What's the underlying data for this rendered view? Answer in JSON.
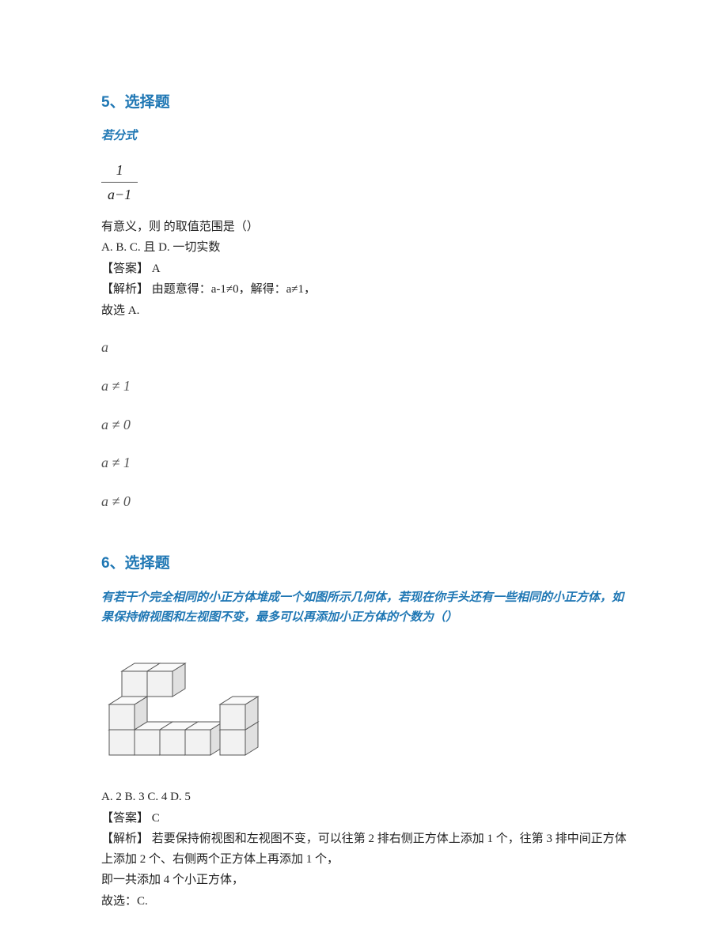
{
  "q5": {
    "header": "5、选择题",
    "stem": "若分式",
    "frac_num": "1",
    "frac_den": "a−1",
    "stem_tail": "有意义，则 的取值范围是（）",
    "options": "A. B. C. 且 D. 一切实数",
    "ans_label": "【答案】",
    "ans_value": "A",
    "exp_label": "【解析】",
    "exp_line1": "由题意得：a-1≠0，解得：a≠1，",
    "exp_line2": "故选 A.",
    "m1": "a",
    "m2": "a ≠ 1",
    "m3": "a ≠ 0",
    "m4": "a ≠ 1",
    "m5": "a ≠ 0"
  },
  "q6": {
    "header": "6、选择题",
    "stem": "有若干个完全相同的小正方体堆成一个如图所示几何体，若现在你手头还有一些相同的小正方体，如果保持俯视图和左视图不变，最多可以再添加小正方体的个数为（）",
    "options": "A. 2 B. 3 C. 4 D. 5",
    "ans_label": "【答案】",
    "ans_value": "C",
    "exp_label": "【解析】",
    "exp_line1": "若要保持俯视图和左视图不变，可以往第 2 排右侧正方体上添加 1 个，往第 3 排中间正方体上添加 2 个、右侧两个正方体上再添加 1 个，",
    "exp_line2": "即一共添加 4 个小正方体，",
    "exp_line3": "故选：C."
  }
}
